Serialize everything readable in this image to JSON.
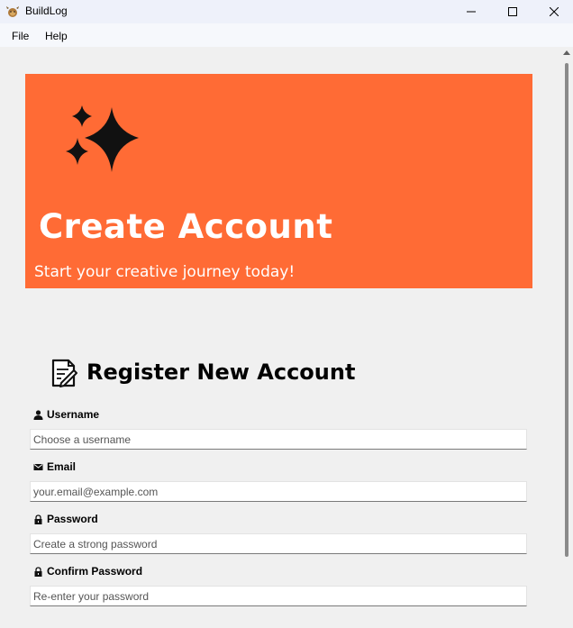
{
  "window": {
    "title": "BuildLog"
  },
  "menu": {
    "file": "File",
    "help": "Help"
  },
  "hero": {
    "title": "Create Account",
    "subtitle": "Start your creative journey today!",
    "background": "#ff6b35"
  },
  "form": {
    "title": "Register New Account",
    "fields": [
      {
        "label": "Username",
        "icon": "person-icon",
        "placeholder": "Choose a username",
        "value": ""
      },
      {
        "label": "Email",
        "icon": "envelope-icon",
        "placeholder": "your.email@example.com",
        "value": ""
      },
      {
        "label": "Password",
        "icon": "lock-icon",
        "placeholder": "Create a strong password",
        "value": ""
      },
      {
        "label": "Confirm Password",
        "icon": "lock-icon",
        "placeholder": "Re-enter your password",
        "value": ""
      }
    ]
  }
}
